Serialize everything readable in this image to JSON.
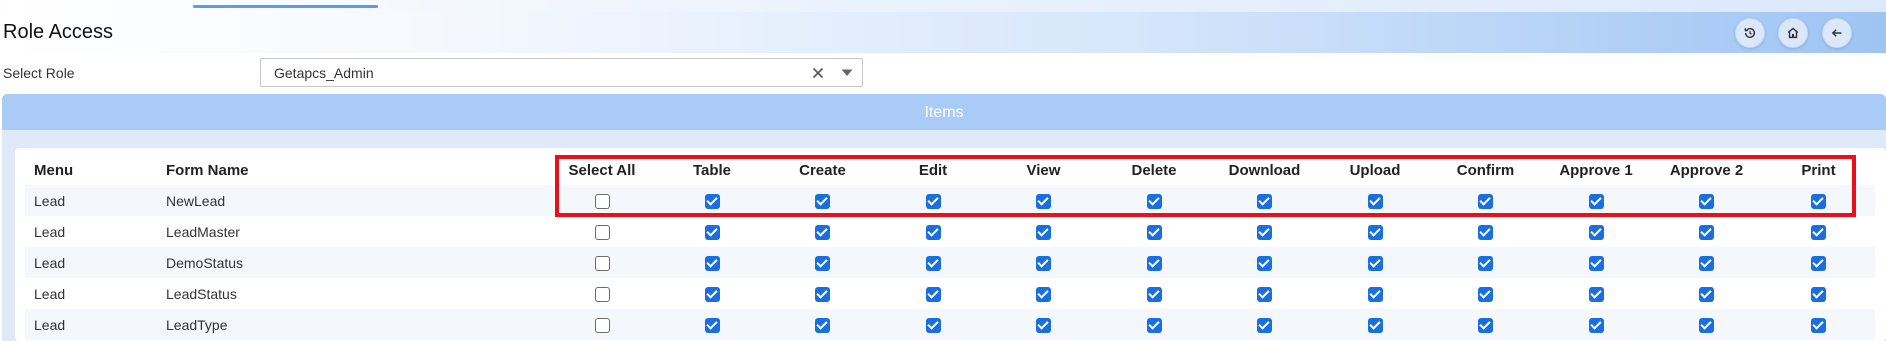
{
  "header": {
    "title": "Role Access",
    "buttons": [
      {
        "name": "history-icon"
      },
      {
        "name": "home-icon"
      },
      {
        "name": "back-arrow-icon"
      }
    ]
  },
  "role": {
    "label": "Select Role",
    "value": "Getapcs_Admin"
  },
  "panel": {
    "title": "Items"
  },
  "table": {
    "columns": [
      "Menu",
      "Form Name",
      "Select All",
      "Table",
      "Create",
      "Edit",
      "View",
      "Delete",
      "Download",
      "Upload",
      "Confirm",
      "Approve 1",
      "Approve 2",
      "Print"
    ],
    "rows": [
      {
        "menu": "Lead",
        "form": "NewLead",
        "select_all": false,
        "perms": [
          true,
          true,
          true,
          true,
          true,
          true,
          true,
          true,
          true,
          true,
          true
        ]
      },
      {
        "menu": "Lead",
        "form": "LeadMaster",
        "select_all": false,
        "perms": [
          true,
          true,
          true,
          true,
          true,
          true,
          true,
          true,
          true,
          true,
          true
        ]
      },
      {
        "menu": "Lead",
        "form": "DemoStatus",
        "select_all": false,
        "perms": [
          true,
          true,
          true,
          true,
          true,
          true,
          true,
          true,
          true,
          true,
          true
        ]
      },
      {
        "menu": "Lead",
        "form": "LeadStatus",
        "select_all": false,
        "perms": [
          true,
          true,
          true,
          true,
          true,
          true,
          true,
          true,
          true,
          true,
          true
        ]
      },
      {
        "menu": "Lead",
        "form": "LeadType",
        "select_all": false,
        "perms": [
          true,
          true,
          true,
          true,
          true,
          true,
          true,
          true,
          true,
          true,
          true
        ]
      }
    ]
  },
  "colors": {
    "accent": "#1a6fe0",
    "panel_header": "#a9cbf6",
    "highlight": "#e8101a"
  }
}
